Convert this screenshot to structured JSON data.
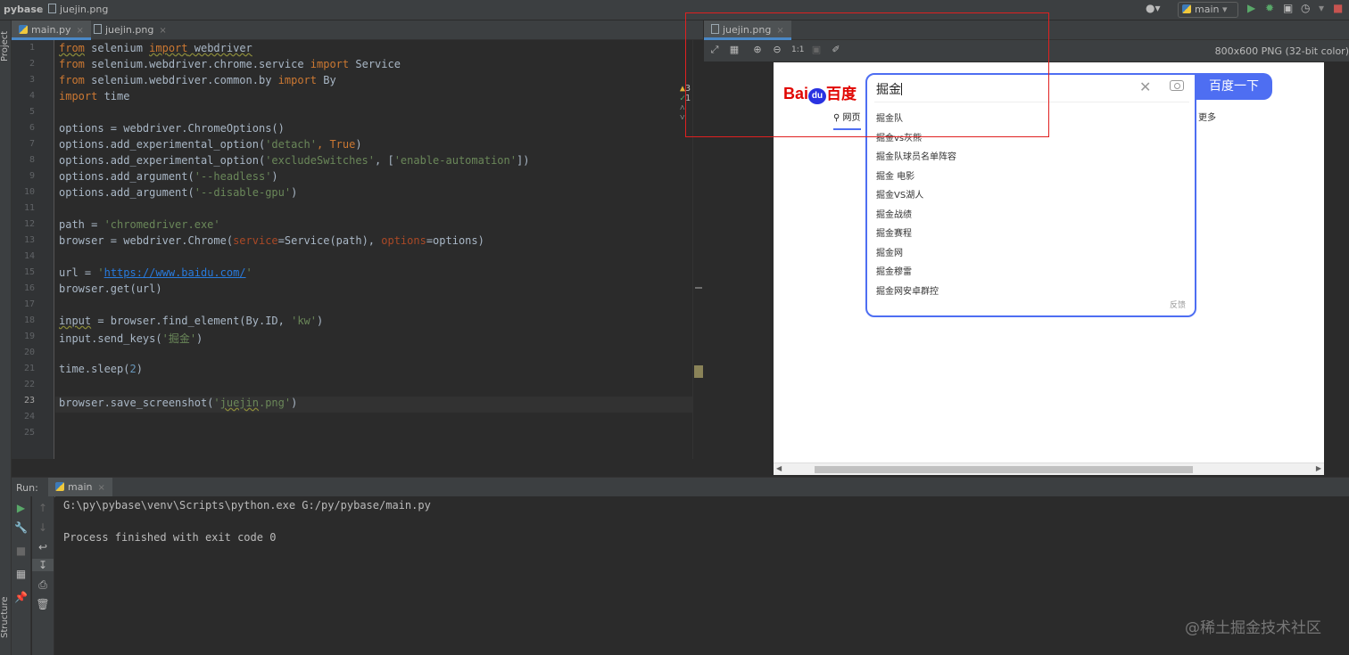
{
  "topbar": {
    "project": "pybase",
    "separator": "›",
    "file": "juejin.png",
    "run_config": "main"
  },
  "left_strip": {
    "project_label": "Project",
    "structure_label": "Structure"
  },
  "editor_tabs": [
    {
      "label": "main.py",
      "close": "×"
    },
    {
      "label": "juejin.png",
      "close": "×"
    }
  ],
  "inspection": {
    "warnings": "3",
    "ok": "1"
  },
  "code_lines": [
    "1",
    "2",
    "3",
    "4",
    "5",
    "6",
    "7",
    "8",
    "9",
    "10",
    "11",
    "12",
    "13",
    "14",
    "15",
    "16",
    "17",
    "18",
    "19",
    "20",
    "21",
    "22",
    "23",
    "24",
    "25"
  ],
  "code": {
    "l1_a": "from",
    "l1_b": " selenium ",
    "l1_c": "import",
    "l1_d": " webdriver",
    "l2_a": "from",
    "l2_b": " selenium.webdriver.chrome.service ",
    "l2_c": "import",
    "l2_d": " Service",
    "l3_a": "from",
    "l3_b": " selenium.webdriver.common.by ",
    "l3_c": "import",
    "l3_d": " By",
    "l4_a": "import",
    "l4_b": " time",
    "l6": "options = webdriver.ChromeOptions()",
    "l7_a": "options.add_experimental_option(",
    "l7_b": "'detach'",
    "l7_c": ", ",
    "l7_d": "True",
    "l7_e": ")",
    "l8_a": "options.add_experimental_option(",
    "l8_b": "'excludeSwitches'",
    "l8_c": ", [",
    "l8_d": "'enable-automation'",
    "l8_e": "])",
    "l9_a": "options.add_argument(",
    "l9_b": "'--headless'",
    "l9_c": ")",
    "l10_a": "options.add_argument(",
    "l10_b": "'--disable-gpu'",
    "l10_c": ")",
    "l12_a": "path = ",
    "l12_b": "'chromedriver.exe'",
    "l13_a": "browser = webdriver.Chrome(",
    "l13_b": "service",
    "l13_c": "=Service(path), ",
    "l13_d": "options",
    "l13_e": "=options)",
    "l15_a": "url = ",
    "l15_b": "'",
    "l15_c": "https://www.baidu.com/",
    "l15_d": "'",
    "l16": "browser.get(url)",
    "l18_a": "input",
    "l18_b": " = browser.find_element(By.ID, ",
    "l18_c": "'kw'",
    "l18_d": ")",
    "l19_a": "input.send_keys(",
    "l19_b": "'掘金'",
    "l19_c": ")",
    "l21_a": "time.sleep(",
    "l21_b": "2",
    "l21_c": ")",
    "l23_a": "browser.save_screenshot(",
    "l23_b": "'",
    "l23_c": "juejin",
    "l23_d": ".png'",
    "l23_e": ")"
  },
  "viewer": {
    "tab": "juejin.png",
    "zoom_actual": "1:1",
    "info": "800x600 PNG (32-bit color)"
  },
  "baidu": {
    "logo_bai": "Bai",
    "logo_du": "du",
    "logo_cn": "百度",
    "search_value": "掘金",
    "submit": "百度一下",
    "tab_web": "网页",
    "tab_more": "更多",
    "suggestions": [
      "掘金队",
      "掘金vs灰熊",
      "掘金队球员名单阵容",
      "掘金 电影",
      "掘金VS湖人",
      "掘金战绩",
      "掘金赛程",
      "掘金网",
      "掘金穆雷",
      "掘金网安卓群控"
    ],
    "feedback": "反馈"
  },
  "run": {
    "label": "Run:",
    "tab": "main",
    "lines": [
      "G:\\py\\pybase\\venv\\Scripts\\python.exe G:/py/pybase/main.py",
      "",
      "Process finished with exit code 0"
    ]
  },
  "watermark": "@稀土掘金技术社区",
  "colors": {
    "ide_bg": "#2b2b2b",
    "panel_bg": "#3c3f41",
    "keyword": "#cc7832",
    "string": "#6a8759",
    "baidu_blue": "#4e6ef2",
    "baidu_red": "#e10602",
    "highlight_box": "#e02020"
  }
}
